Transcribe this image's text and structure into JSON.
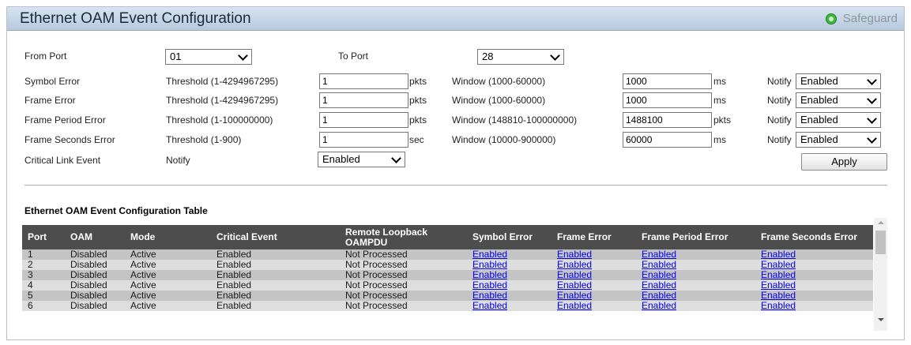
{
  "header": {
    "title": "Ethernet OAM Event Configuration",
    "safeguard": "Safeguard"
  },
  "ports": {
    "from_label": "From Port",
    "from_value": "01",
    "to_label": "To Port",
    "to_value": "28"
  },
  "events": [
    {
      "name": "Symbol Error",
      "threshold_label": "Threshold (1-4294967295)",
      "threshold": "1",
      "threshold_unit": "pkts",
      "window_label": "Window (1000-60000)",
      "window": "1000",
      "window_unit": "ms",
      "notify_label": "Notify",
      "notify": "Enabled"
    },
    {
      "name": "Frame Error",
      "threshold_label": "Threshold (1-4294967295)",
      "threshold": "1",
      "threshold_unit": "pkts",
      "window_label": "Window (1000-60000)",
      "window": "1000",
      "window_unit": "ms",
      "notify_label": "Notify",
      "notify": "Enabled"
    },
    {
      "name": "Frame Period Error",
      "threshold_label": "Threshold (1-100000000)",
      "threshold": "1",
      "threshold_unit": "pkts",
      "window_label": "Window (148810-100000000)",
      "window": "1488100",
      "window_unit": "pkts",
      "notify_label": "Notify",
      "notify": "Enabled"
    },
    {
      "name": "Frame Seconds Error",
      "threshold_label": "Threshold (1-900)",
      "threshold": "1",
      "threshold_unit": "sec",
      "window_label": "Window (10000-900000)",
      "window": "60000",
      "window_unit": "ms",
      "notify_label": "Notify",
      "notify": "Enabled"
    }
  ],
  "critical": {
    "name": "Critical Link Event",
    "notify_label": "Notify",
    "notify": "Enabled"
  },
  "apply_label": "Apply",
  "table": {
    "title": "Ethernet OAM Event Configuration Table",
    "headers": [
      "Port",
      "OAM",
      "Mode",
      "Critical Event",
      "Remote Loopback OAMPDU",
      "Symbol Error",
      "Frame Error",
      "Frame Period Error",
      "Frame Seconds Error"
    ],
    "rows": [
      [
        "1",
        "Disabled",
        "Active",
        "Enabled",
        "Not Processed",
        "Enabled",
        "Enabled",
        "Enabled",
        "Enabled"
      ],
      [
        "2",
        "Disabled",
        "Active",
        "Enabled",
        "Not Processed",
        "Enabled",
        "Enabled",
        "Enabled",
        "Enabled"
      ],
      [
        "3",
        "Disabled",
        "Active",
        "Enabled",
        "Not Processed",
        "Enabled",
        "Enabled",
        "Enabled",
        "Enabled"
      ],
      [
        "4",
        "Disabled",
        "Active",
        "Enabled",
        "Not Processed",
        "Enabled",
        "Enabled",
        "Enabled",
        "Enabled"
      ],
      [
        "5",
        "Disabled",
        "Active",
        "Enabled",
        "Not Processed",
        "Enabled",
        "Enabled",
        "Enabled",
        "Enabled"
      ],
      [
        "6",
        "Disabled",
        "Active",
        "Enabled",
        "Not Processed",
        "Enabled",
        "Enabled",
        "Enabled",
        "Enabled"
      ]
    ]
  },
  "colors": {
    "header_bg": "#4d4d4d",
    "row_odd": "#c4c4c4",
    "row_even": "#dedede",
    "link": "#0000ee",
    "safeguard_icon": "#3fb83f"
  },
  "icons": {
    "safeguard": "safeguard-icon",
    "dropdown": "chevron-down-icon"
  }
}
